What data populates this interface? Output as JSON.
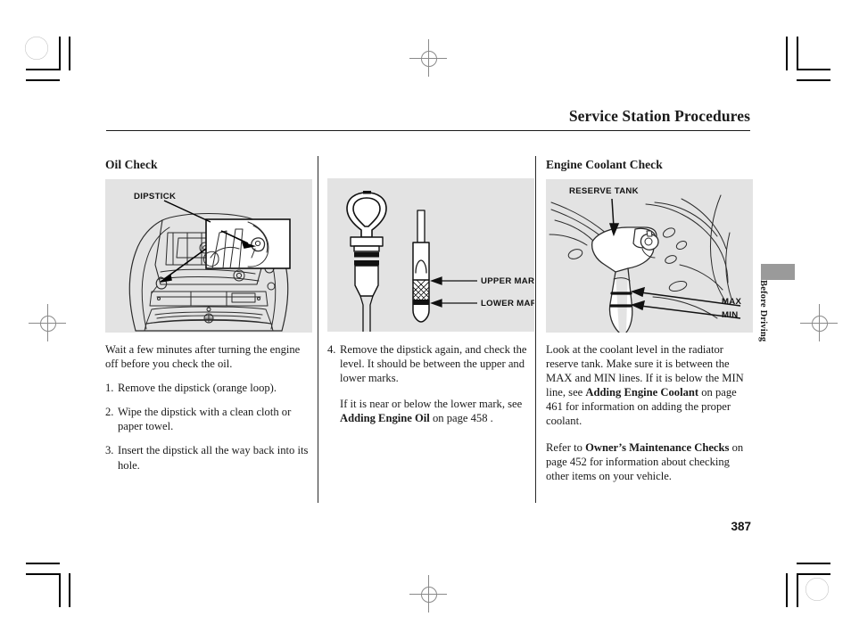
{
  "page": {
    "header_title": "Service Station Procedures",
    "folio": "387",
    "thumb_tab_label": "Before Driving"
  },
  "columns": [
    {
      "heading": "Oil Check",
      "figure": {
        "name": "engine-bay-dipstick-illustration",
        "labels": [
          {
            "text": "DIPSTICK",
            "name": "dipstick-callout-label"
          }
        ]
      },
      "intro": "Wait a few minutes after turning the engine off before you check the oil.",
      "steps": [
        {
          "num": "1.",
          "text": "Remove the dipstick (orange loop)."
        },
        {
          "num": "2.",
          "text": "Wipe the dipstick with a clean cloth or paper towel."
        },
        {
          "num": "3.",
          "text": "Insert the dipstick all the way back into its hole."
        }
      ]
    },
    {
      "heading": "",
      "figure": {
        "name": "dipstick-detail-illustration",
        "labels": [
          {
            "text": "UPPER MARK",
            "name": "upper-mark-callout-label"
          },
          {
            "text": "LOWER MARK",
            "name": "lower-mark-callout-label"
          }
        ]
      },
      "steps": [
        {
          "num": "4.",
          "text": "Remove the dipstick again, and check the level. It should be between the upper and lower marks."
        }
      ],
      "paragraphs": [
        {
          "parts": [
            {
              "text": "If it is near or below the lower mark, see ",
              "bold": false
            },
            {
              "text": "Adding Engine Oil",
              "bold": true
            },
            {
              "text": " on page 458 .",
              "bold": false
            }
          ]
        }
      ]
    },
    {
      "heading": "Engine Coolant Check",
      "figure": {
        "name": "coolant-reserve-tank-illustration",
        "labels": [
          {
            "text": "RESERVE TANK",
            "name": "reserve-tank-callout-label"
          },
          {
            "text": "MAX",
            "name": "max-line-callout-label"
          },
          {
            "text": "MIN",
            "name": "min-line-callout-label"
          }
        ]
      },
      "paragraphs": [
        {
          "parts": [
            {
              "text": "Look at the coolant level in the radiator reserve tank. Make sure it is between the MAX and MIN lines. If it is below the MIN line, see ",
              "bold": false
            },
            {
              "text": "Adding Engine Coolant",
              "bold": true
            },
            {
              "text": " on page 461 for information on adding the proper coolant.",
              "bold": false
            }
          ]
        },
        {
          "parts": [
            {
              "text": "Refer to ",
              "bold": false
            },
            {
              "text": "Owner’s Maintenance Checks",
              "bold": true
            },
            {
              "text": " on page 452 for information about checking other items on your vehicle.",
              "bold": false
            }
          ]
        }
      ]
    }
  ],
  "print_marks": {
    "registration_target": "registration-target-mark",
    "registration_crosshair": "registration-crosshair-mark",
    "crop_mark": "crop-mark"
  },
  "colors": {
    "figure_background": "#e3e3e3",
    "text": "#1a1a1a",
    "thumb_tab": "#9a9a9a"
  }
}
